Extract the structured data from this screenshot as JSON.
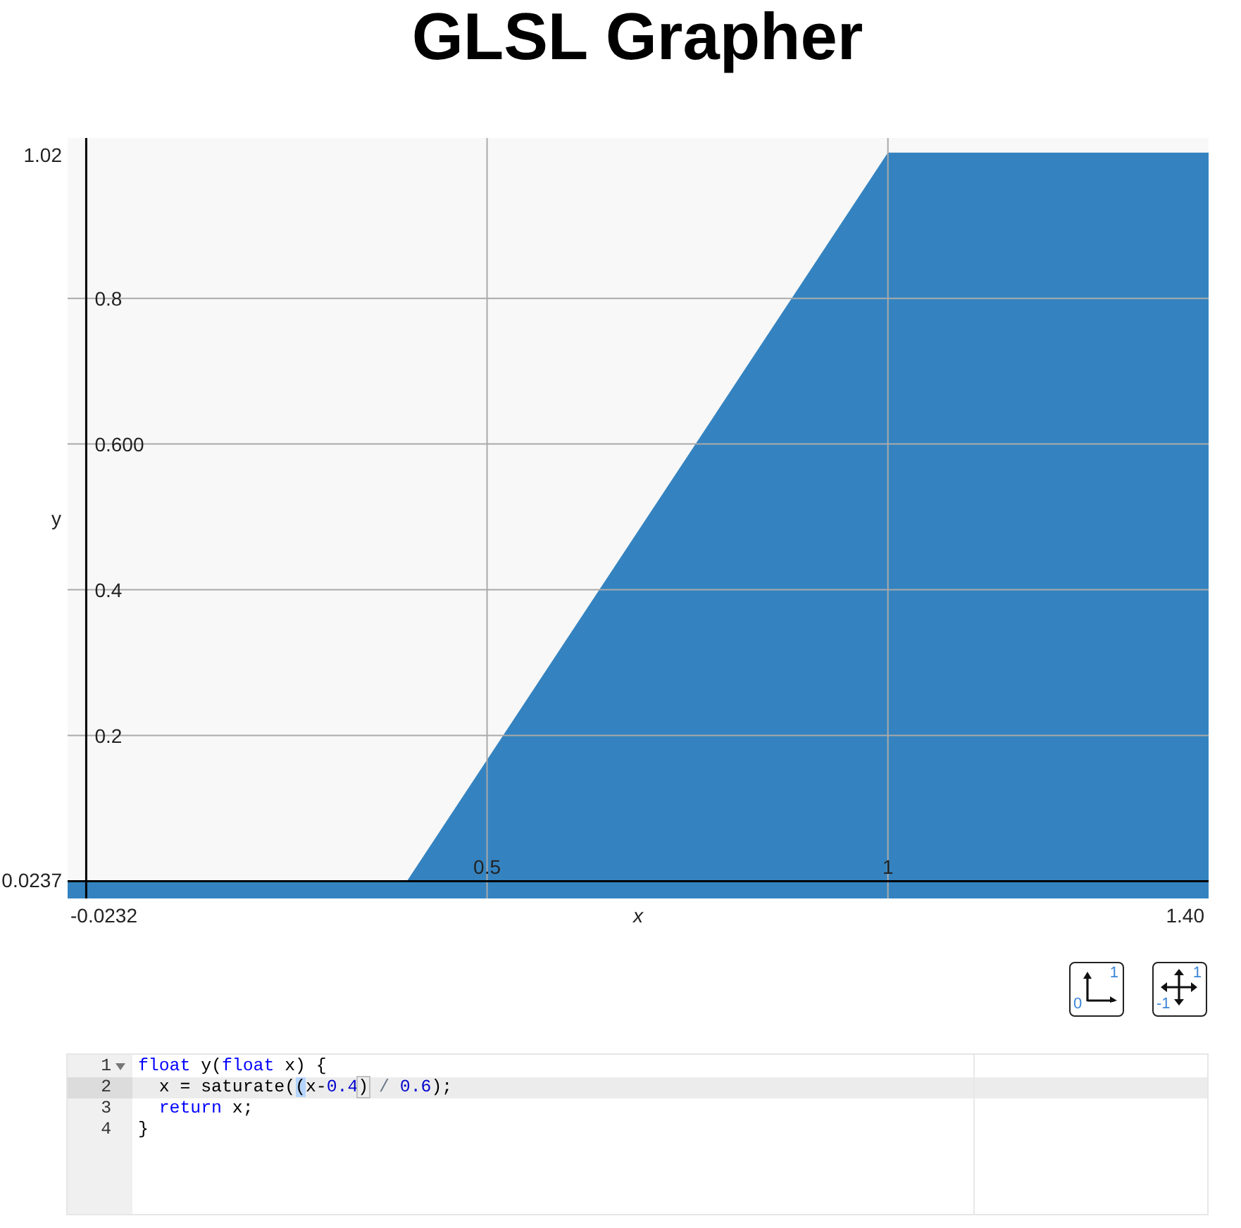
{
  "title": "GLSL Grapher",
  "graph": {
    "chart_data": {
      "type": "area",
      "xlabel": "x",
      "ylabel": "y",
      "x": [
        -0.0232,
        0.4,
        1,
        1.4
      ],
      "series": [
        {
          "color": "#3483c0",
          "values": [
            0,
            0,
            1,
            1
          ]
        }
      ],
      "xlim": [
        -0.0232,
        1.4
      ],
      "ylim": [
        -0.0237,
        1.02
      ],
      "xticks": [
        0.5,
        1
      ],
      "yticks": [
        0.2,
        0.4,
        {
          "value": 0.6,
          "label": "0.600"
        },
        0.8
      ],
      "grid": true,
      "bands": [
        {
          "axis": "y",
          "from": -0.0237,
          "to": 0,
          "color": "#3483c0"
        }
      ]
    },
    "range_labels": {
      "y_max": "1.02",
      "y_min": "0.0237",
      "x_min": "-0.0232",
      "x_max": "1.40"
    }
  },
  "view_buttons": [
    {
      "kind": "unit",
      "low": "0",
      "high": "1"
    },
    {
      "kind": "signed",
      "low": "-1",
      "high": "1"
    }
  ],
  "editor": {
    "lines": [
      {
        "number": "1",
        "foldable": true,
        "active": false,
        "tokens": [
          {
            "kind": "keyword",
            "text": "float"
          },
          {
            "kind": "plain",
            "text": " y("
          },
          {
            "kind": "keyword",
            "text": "float"
          },
          {
            "kind": "plain",
            "text": " x) {"
          }
        ]
      },
      {
        "number": "2",
        "foldable": false,
        "active": true,
        "tokens": [
          {
            "kind": "plain",
            "text": "  x = saturate("
          },
          {
            "kind": "selected",
            "text": "("
          },
          {
            "kind": "plain",
            "text": "x-"
          },
          {
            "kind": "number",
            "text": "0.4"
          },
          {
            "kind": "match",
            "text": ")"
          },
          {
            "kind": "operator",
            "text": " / "
          },
          {
            "kind": "number",
            "text": "0.6"
          },
          {
            "kind": "plain",
            "text": ");"
          }
        ]
      },
      {
        "number": "3",
        "foldable": false,
        "active": false,
        "tokens": [
          {
            "kind": "keyword",
            "text": "  return"
          },
          {
            "kind": "plain",
            "text": " x;"
          }
        ]
      },
      {
        "number": "4",
        "foldable": false,
        "active": false,
        "tokens": [
          {
            "kind": "plain",
            "text": "}"
          }
        ]
      }
    ]
  }
}
